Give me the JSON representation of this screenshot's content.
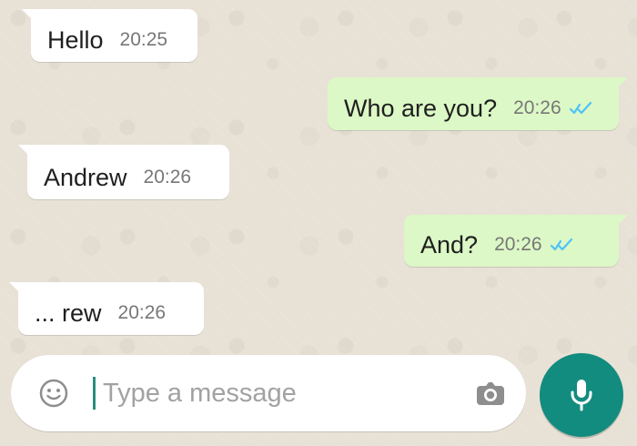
{
  "chat": {
    "messages": [
      {
        "direction": "incoming",
        "text": "Hello",
        "time": "20:25"
      },
      {
        "direction": "outgoing",
        "text": "Who are you?",
        "time": "20:26",
        "status_icon": "double-check-icon"
      },
      {
        "direction": "incoming",
        "text": "Andrew",
        "time": "20:26"
      },
      {
        "direction": "outgoing",
        "text": "And?",
        "time": "20:26",
        "status_icon": "double-check-icon"
      },
      {
        "direction": "incoming",
        "text": "... rew",
        "time": "20:26"
      }
    ]
  },
  "composer": {
    "placeholder": "Type a message",
    "emoji_icon": "emoji-icon",
    "camera_icon": "camera-icon",
    "mic_icon": "mic-icon"
  },
  "colors": {
    "background": "#e8e1d6",
    "incoming_bubble": "#ffffff",
    "outgoing_bubble": "#dcf8c6",
    "accent": "#128c7e",
    "read_ticks": "#4fc3f7",
    "time_text": "#777777"
  }
}
